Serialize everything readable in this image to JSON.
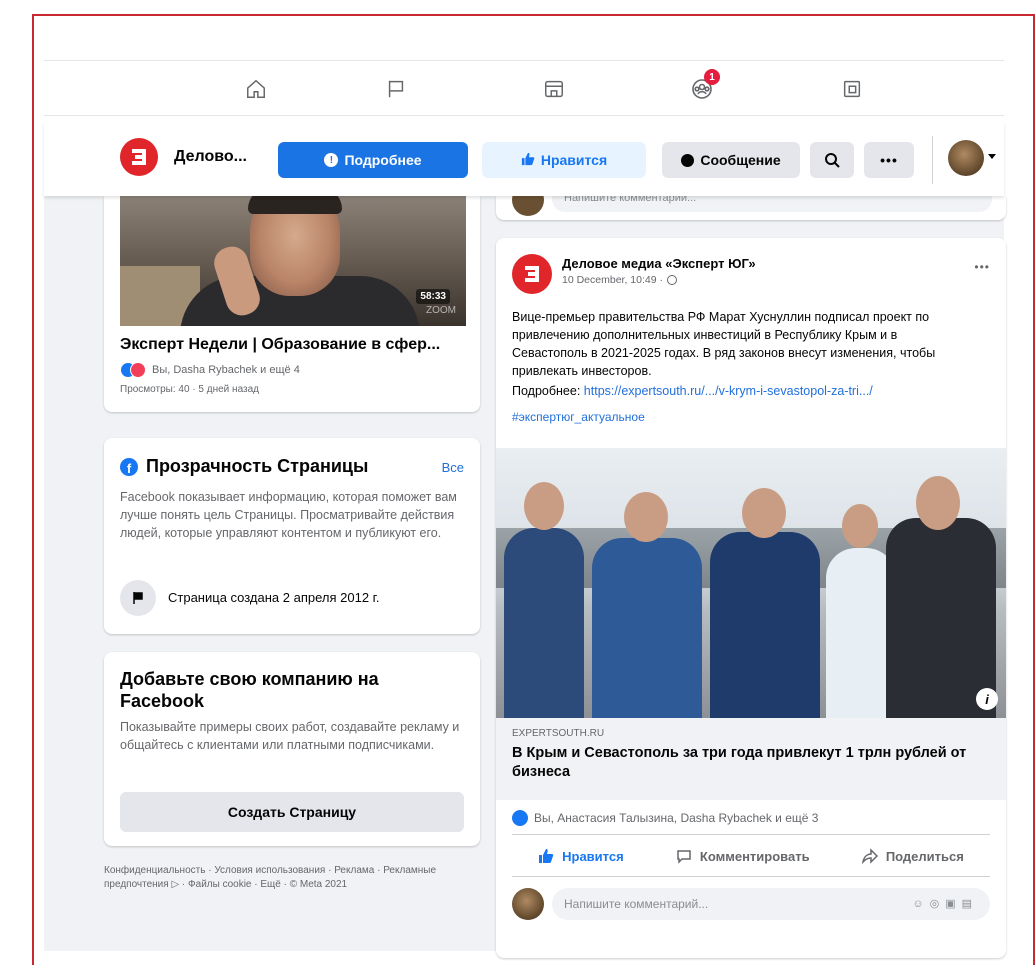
{
  "nav": {
    "items": [
      "home-icon",
      "flag-icon",
      "shop-icon",
      "groups-icon",
      "page-icon"
    ],
    "badge_count": "1"
  },
  "page_bar": {
    "page_name": "Делово...",
    "more_button": "Подробнее",
    "like_button": "Нравится",
    "message_button": "Сообщение",
    "search_icon": "search-icon",
    "more_icon": "ellipsis-icon"
  },
  "video": {
    "duration": "58:33",
    "watermark": "ZOOM",
    "title": "Эксперт Недели | Образование в сфер...",
    "reactions": "Вы, Dasha Rybachek и ещё 4",
    "meta": "Просмотры: 40 · 5 дней назад"
  },
  "transparency": {
    "title": "Прозрачность Страницы",
    "see_all": "Все",
    "body": "Facebook показывает информацию, которая поможет вам лучше понять цель Страницы. Просматривайте действия людей, которые управляют контентом и публикуют его.",
    "created": "Страница создана 2 апреля 2012 г."
  },
  "business": {
    "title": "Добавьте свою компанию на Facebook",
    "body": "Показывайте примеры своих работ, создавайте рекламу и общайтесь с клиентами или платными подписчиками.",
    "button": "Создать Страницу"
  },
  "footer": {
    "text": "Конфиденциальность · Условия использования · Реклама · Рекламные предпочтения ▷ · Файлы cookie · Ещё · © Meta 2021"
  },
  "prev_comment": {
    "placeholder": "Напишите комментарий..."
  },
  "post": {
    "author": "Деловое медиа «Эксперт ЮГ»",
    "time": "10 December, 10:49 ·",
    "body": "Вице-премьер правительства РФ Марат Хуснуллин подписал проект по привлечению дополнительных инвестиций в Республику Крым и в Севастополь в 2021-2025 годах. В ряд законов внесут изменения, чтобы привлекать инвесторов.",
    "more_label": "Подробнее:",
    "more_link": "https://expertsouth.ru/.../v-krym-i-sevastopol-za-tri.../",
    "hashtag": "#экспертюг_актуальное",
    "link_domain": "EXPERTSOUTH.RU",
    "link_title": "В Крым и Севастополь за три года привлекут 1 трлн рублей от бизнеса",
    "reactions": "Вы, Анастасия Талызина, Dasha Rybachek и ещё 3",
    "like": "Нравится",
    "comment": "Комментировать",
    "share": "Поделиться",
    "comment_placeholder": "Напишите комментарий..."
  },
  "colors": {
    "brand_red": "#e0252b",
    "fb_blue": "#1877f2",
    "frame_red": "#c8282e"
  }
}
